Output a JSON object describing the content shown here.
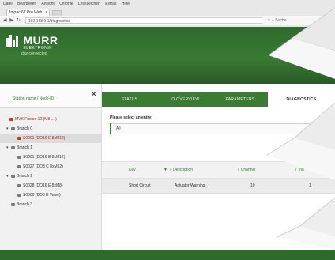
{
  "browser": {
    "menu": [
      "Datei",
      "Bearbeiten",
      "Ansicht",
      "Chronik",
      "Lesezeichen",
      "Extras",
      "Hilfe"
    ],
    "tab_title": "Impact67 Pro Web",
    "tab_close": "×",
    "nav_glyphs": "◀ ▶ ↻",
    "url": "192.168.0.1/diagnostics",
    "url_right": "☆ ⌂ Suche"
  },
  "header": {
    "brand": "MURR",
    "brand_sub": "ELEKTRONIK",
    "tagline": "stay connected"
  },
  "sidebar": {
    "search_label": "Station name / Node-ID",
    "close_glyph": "✕",
    "tree": [
      {
        "label": "MVK Fusion 10 (M8 ... )",
        "indent": 0,
        "toggle": "",
        "icon": "red",
        "text_red": true,
        "selected": false
      },
      {
        "label": "Branch 0",
        "indent": 1,
        "toggle": "▾",
        "icon": "gray",
        "text_red": false,
        "selected": false
      },
      {
        "label": "S0001 (DO16 E 8xM12)",
        "indent": 2,
        "toggle": "",
        "icon": "red",
        "text_red": true,
        "selected": true
      },
      {
        "label": "Branch 1",
        "indent": 1,
        "toggle": "▾",
        "icon": "gray",
        "text_red": false,
        "selected": false
      },
      {
        "label": "S0001 (DO16 E 8xM12)",
        "indent": 2,
        "toggle": "",
        "icon": "gray",
        "text_red": false,
        "selected": false
      },
      {
        "label": "S0027 (DO8 C 8xM12)",
        "indent": 2,
        "toggle": "",
        "icon": "gray",
        "text_red": false,
        "selected": false
      },
      {
        "label": "Branch 2",
        "indent": 1,
        "toggle": "▾",
        "icon": "gray",
        "text_red": false,
        "selected": false
      },
      {
        "label": "S0028 (DO16 E 8xM8)",
        "indent": 2,
        "toggle": "",
        "icon": "gray",
        "text_red": false,
        "selected": false
      },
      {
        "label": "S0000 (DO8 E Valve)",
        "indent": 2,
        "toggle": "",
        "icon": "gray",
        "text_red": false,
        "selected": false
      },
      {
        "label": "Branch 3",
        "indent": 1,
        "toggle": "",
        "icon": "gray",
        "text_red": false,
        "selected": false
      }
    ]
  },
  "main": {
    "tabs": [
      {
        "label": "STATUS",
        "active": false
      },
      {
        "label": "IO OVERVIEW",
        "active": false
      },
      {
        "label": "PARAMETERS",
        "active": false
      },
      {
        "label": "DIAGNOSTICS",
        "active": true
      }
    ],
    "select_prompt": "Please select an entry:",
    "entry_value": "All",
    "table": {
      "headers": [
        "Key",
        "▼ ⊤ Description",
        "⊤ Channel",
        "⊤ Ind"
      ],
      "rows": [
        [
          "Short Circuit",
          "Actuator Warning",
          "10",
          "1"
        ]
      ]
    }
  },
  "colors": {
    "brand_green": "#3c7b34",
    "error_red": "#b3261e"
  }
}
